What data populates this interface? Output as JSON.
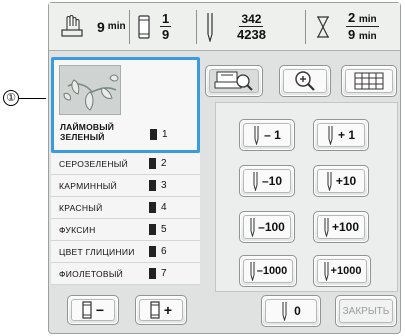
{
  "callout": {
    "number": "①"
  },
  "status": {
    "time_value": "9",
    "time_unit": "min",
    "color_current": "1",
    "color_total": "9",
    "stitch_current": "342",
    "stitch_total": "4238",
    "remaining_value": "2",
    "remaining_unit": "min",
    "total_value": "9",
    "total_unit": "min"
  },
  "current_color": {
    "name_line1": "ЛАЙМОВЫЙ",
    "name_line2": "ЗЕЛЕНЫЙ",
    "number": "1"
  },
  "color_list": [
    {
      "name": "СЕРОЗЕЛЕНЫЙ",
      "number": "2"
    },
    {
      "name": "КАРМИННЫЙ",
      "number": "3"
    },
    {
      "name": "КРАСНЫЙ",
      "number": "4"
    },
    {
      "name": "ФУКСИН",
      "number": "5"
    },
    {
      "name": "ЦВЕТ ГЛИЦИНИИ",
      "number": "6"
    },
    {
      "name": "ФИОЛЕТОВЫЙ",
      "number": "7"
    }
  ],
  "color_buttons": {
    "minus": "−",
    "plus": "+"
  },
  "stitch_buttons": {
    "minus_1": "– 1",
    "plus_1": "+ 1",
    "minus_10": "–10",
    "plus_10": "+10",
    "minus_100": "–100",
    "plus_100": "+100",
    "minus_1000": "–1000",
    "plus_1000": "+1000",
    "zero": "0"
  },
  "close_label": "ЗАКРЫТЬ",
  "colors": {
    "accent": "#3b9be0",
    "panel": "#dfe2e0"
  }
}
